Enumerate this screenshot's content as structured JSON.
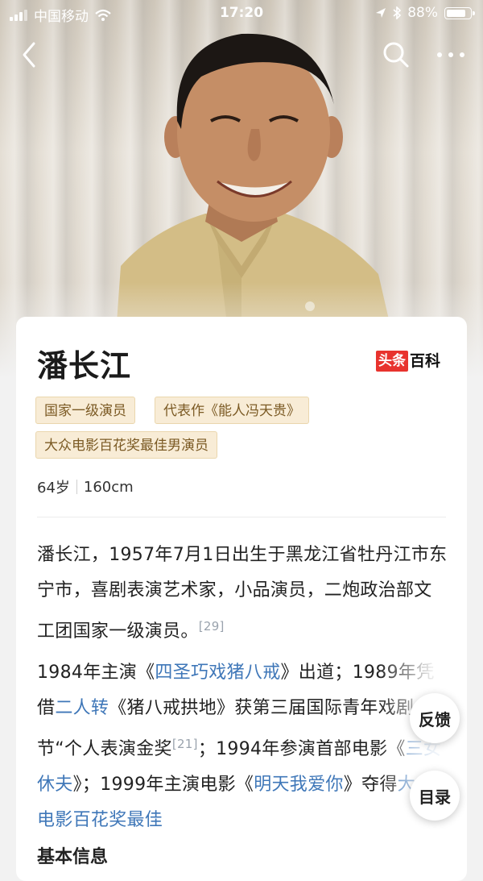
{
  "status_bar": {
    "carrier": "中国移动",
    "time": "17:20",
    "battery_text": "88%",
    "battery_level": 0.88,
    "icons": [
      "signal-icon",
      "wifi-icon",
      "location-icon",
      "bluetooth-icon",
      "battery-icon"
    ]
  },
  "nav": {
    "back_icon": "chevron-left-icon",
    "search_icon": "search-icon",
    "more_icon": "more-dots-icon"
  },
  "hero": {
    "image": "portrait-photo"
  },
  "entry": {
    "title": "潘长江",
    "brand_red": "头条",
    "brand_black": "百科",
    "tags": [
      "国家一级演员",
      "代表作《能人冯天贵》",
      "大众电影百花奖最佳男演员"
    ],
    "age": "64岁",
    "height": "160cm"
  },
  "para1": {
    "text": "潘长江，1957年7月1日出生于黑龙江省牡丹江市东宁市，喜剧表演艺术家，小品演员，二炮政治部文工团国家一级演员。",
    "ref": "[29]"
  },
  "para2": {
    "t1": "1984年主演《",
    "l1": "四圣巧戏猪八戒",
    "t2": "》出道；1989年凭借",
    "l2": "二人转",
    "t3": "《猪八戒拱地》获第三届国际青年戏剧节“个人表演金奖",
    "ref": "[21]",
    "t4": "；1994年参演首部电影《",
    "l3": "三女休夫",
    "t5": "》；1999年主演电影《",
    "l4": "明天我爱你",
    "t6": "》夺得",
    "l5": "大众电影百花奖最佳"
  },
  "section_title": "基本信息",
  "floating": {
    "feedback": "反馈",
    "toc": "目录"
  }
}
